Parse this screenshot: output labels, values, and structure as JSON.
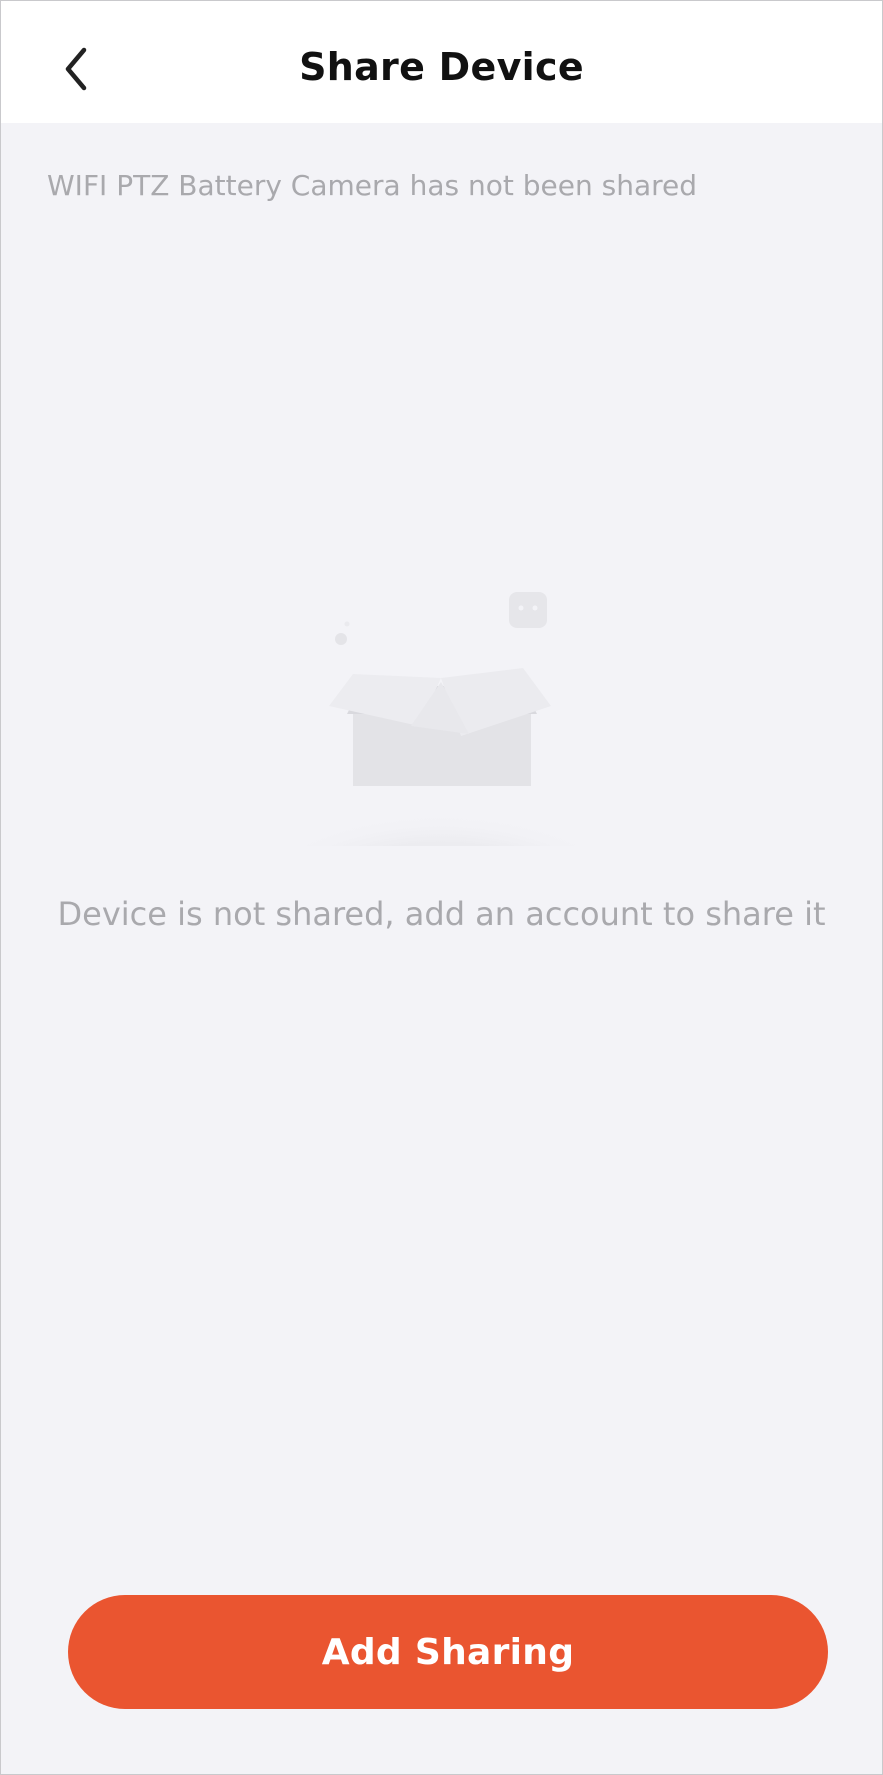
{
  "header": {
    "title": "Share Device",
    "back_icon": "chevron-left-icon"
  },
  "device_status": "WIFI PTZ Battery Camera  has not been shared",
  "empty_state": {
    "illustration_icon": "empty-box-icon",
    "message": "Device is not shared, add an account to share it"
  },
  "actions": {
    "add_sharing_label": "Add Sharing"
  },
  "colors": {
    "accent": "#ea5530",
    "background": "#f3f3f7",
    "header_background": "#ffffff",
    "muted_text": "#a9a9ad"
  }
}
